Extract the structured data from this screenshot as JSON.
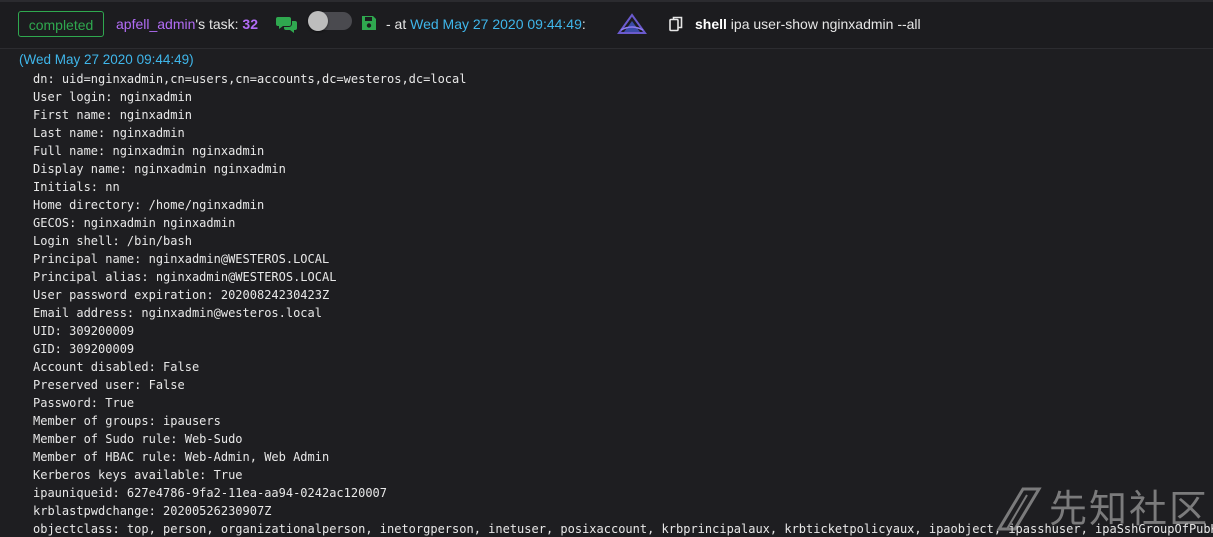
{
  "header": {
    "status": "completed",
    "operator": "apfell_admin",
    "task_label": "'s task: ",
    "task_number": "32",
    "at_prefix": "- at ",
    "timestamp": "Wed May 27 2020 09:44:49",
    "timestamp_suffix": ":",
    "command_name": "shell",
    "command_args": " ipa user-show nginxadmin --all",
    "icons": {
      "comment": "comment-icon",
      "toggle": "toggle-switch",
      "save": "save-icon",
      "logo": "mythic-logo-icon",
      "copy": "copy-icon"
    },
    "colors": {
      "completed": "#2fa84f",
      "operator": "#b26cf5",
      "timestamp": "#3fb6ea",
      "comment": "#2fa84f"
    }
  },
  "output": {
    "response_time": "(Wed May 27 2020 09:44:49)",
    "lines": [
      "dn: uid=nginxadmin,cn=users,cn=accounts,dc=westeros,dc=local",
      "User login: nginxadmin",
      "First name: nginxadmin",
      "Last name: nginxadmin",
      "Full name: nginxadmin nginxadmin",
      "Display name: nginxadmin nginxadmin",
      "Initials: nn",
      "Home directory: /home/nginxadmin",
      "GECOS: nginxadmin nginxadmin",
      "Login shell: /bin/bash",
      "Principal name: nginxadmin@WESTEROS.LOCAL",
      "Principal alias: nginxadmin@WESTEROS.LOCAL",
      "User password expiration: 20200824230423Z",
      "Email address: nginxadmin@westeros.local",
      "UID: 309200009",
      "GID: 309200009",
      "Account disabled: False",
      "Preserved user: False",
      "Password: True",
      "Member of groups: ipausers",
      "Member of Sudo rule: Web-Sudo",
      "Member of HBAC rule: Web-Admin, Web Admin",
      "Kerberos keys available: True",
      "ipauniqueid: 627e4786-9fa2-11ea-aa94-0242ac120007",
      "krblastpwdchange: 20200526230907Z",
      "objectclass: top, person, organizationalperson, inetorgperson, inetuser, posixaccount, krbprincipalaux, krbticketpolicyaux, ipaobject, ipasshuser, ipaSshGroupOfPubKeys"
    ]
  },
  "watermark": {
    "text": "先知社区"
  }
}
